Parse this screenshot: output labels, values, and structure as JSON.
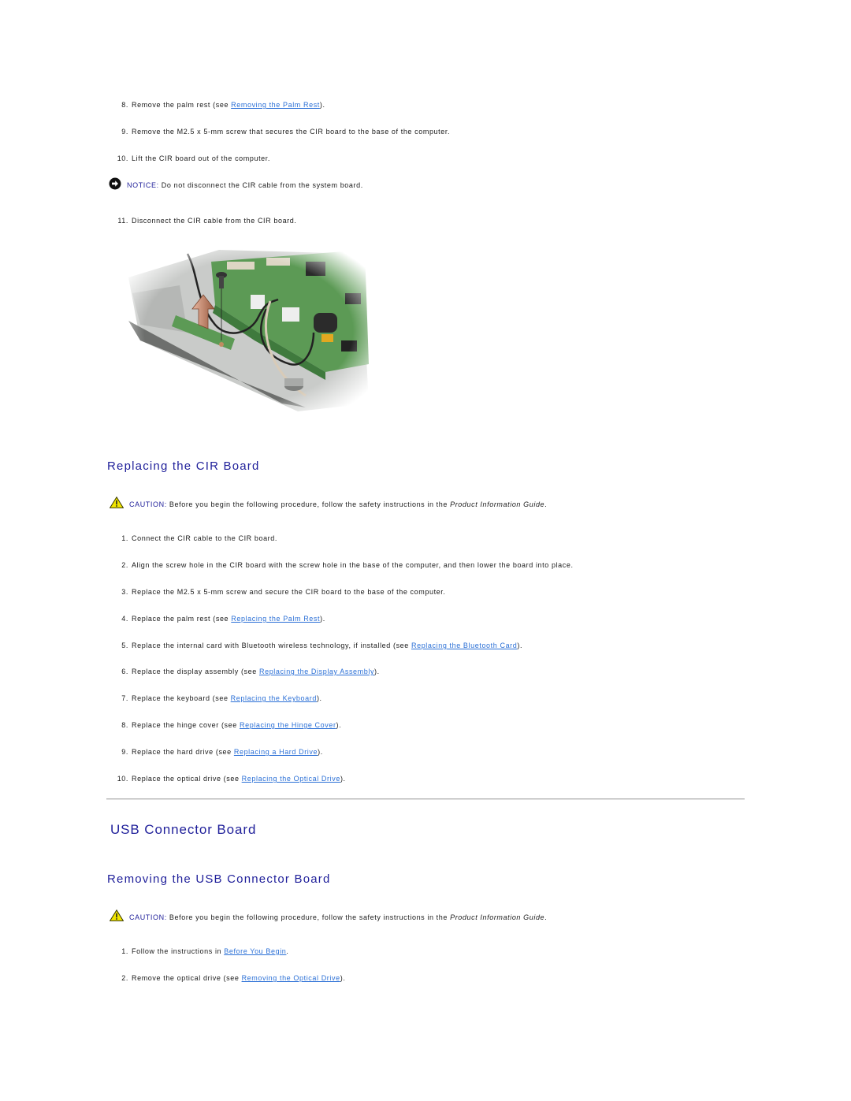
{
  "removal_steps_continued": [
    {
      "num": "8.",
      "text_before": "Remove the palm rest (see ",
      "link": "Removing the Palm Rest",
      "text_after": ")."
    },
    {
      "num": "9.",
      "text_before": "Remove the M2.5 x 5-mm screw that secures the CIR board to the base of the computer.",
      "link": null,
      "text_after": ""
    },
    {
      "num": "10.",
      "text_before": "Lift the CIR board out of the computer.",
      "link": null,
      "text_after": ""
    }
  ],
  "notice": {
    "icon": "notice-arrow-circle-icon",
    "label": "NOTICE:",
    "text": " Do not disconnect the CIR cable from the system board."
  },
  "removal_step_11": {
    "num": "11.",
    "text": "Disconnect the CIR cable from the CIR board."
  },
  "figure": {
    "alt": "CIR board being lifted out of computer base"
  },
  "replacing_cir": {
    "heading": "Replacing the CIR Board",
    "caution": {
      "icon": "caution-triangle-icon",
      "label": "CAUTION:",
      "text_before": " Before you begin the following procedure, follow the safety instructions in the ",
      "emphasis": "Product Information Guide",
      "text_after": "."
    },
    "steps": [
      {
        "num": "1.",
        "text_before": "Connect the CIR cable to the CIR board.",
        "link": null,
        "text_after": ""
      },
      {
        "num": "2.",
        "text_before": "Align the screw hole in the CIR board with the screw hole in the base of the computer, and then lower the board into place.",
        "link": null,
        "text_after": ""
      },
      {
        "num": "3.",
        "text_before": "Replace the M2.5 x 5-mm screw and secure the CIR board to the base of the computer.",
        "link": null,
        "text_after": ""
      },
      {
        "num": "4.",
        "text_before": "Replace the palm rest (see ",
        "link": "Replacing the Palm Rest",
        "text_after": ")."
      },
      {
        "num": "5.",
        "text_before": "Replace the internal card with Bluetooth wireless technology, if installed (see ",
        "link": "Replacing the Bluetooth Card",
        "text_after": ")."
      },
      {
        "num": "6.",
        "text_before": "Replace the display assembly (see ",
        "link": "Replacing the Display Assembly",
        "text_after": ")."
      },
      {
        "num": "7.",
        "text_before": "Replace the keyboard (see ",
        "link": "Replacing the Keyboard",
        "text_after": ")."
      },
      {
        "num": "8.",
        "text_before": "Replace the hinge cover (see ",
        "link": "Replacing the Hinge Cover",
        "text_after": ")."
      },
      {
        "num": "9.",
        "text_before": "Replace the hard drive (see ",
        "link": "Replacing a Hard Drive",
        "text_after": ")."
      },
      {
        "num": "10.",
        "text_before": "Replace the optical drive (see ",
        "link": "Replacing the Optical Drive",
        "text_after": ")."
      }
    ]
  },
  "usb_section": {
    "heading": "USB Connector Board",
    "removing": {
      "heading": "Removing the USB Connector Board",
      "caution": {
        "icon": "caution-triangle-icon",
        "label": "CAUTION:",
        "text_before": " Before you begin the following procedure, follow the safety instructions in the ",
        "emphasis": "Product Information Guide",
        "text_after": "."
      },
      "steps": [
        {
          "num": "1.",
          "text_before": "Follow the instructions in ",
          "link": "Before You Begin",
          "text_after": "."
        },
        {
          "num": "2.",
          "text_before": "Remove the optical drive (see ",
          "link": "Removing the Optical Drive",
          "text_after": ")."
        }
      ]
    }
  },
  "colors": {
    "heading": "#1f1f9a",
    "link": "#2a6fd6",
    "body_text": "#1a1a1a",
    "caution_yellow": "#f2e600"
  }
}
